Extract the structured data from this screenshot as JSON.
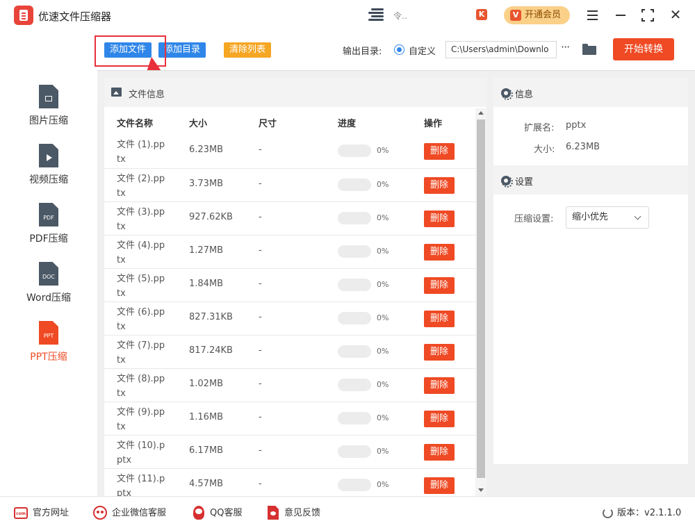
{
  "window": {
    "title": "优速文件压缩器",
    "user_name": "令‥",
    "vip_label": "开通会员",
    "vip_icon_text": "V",
    "k_badge": "K"
  },
  "toolbar": {
    "add_file_label": "添加文件",
    "add_dir_label": "添加目录",
    "clear_label": "清除列表",
    "output_dir_label": "输出目录:",
    "custom_label": "自定义",
    "path_value": "C:\\Users\\admin\\Downlo",
    "more_label": "···",
    "start_label": "开始转换"
  },
  "sidebar": {
    "items": [
      {
        "label": "图片压缩",
        "icon": "image-doc-icon",
        "active": false
      },
      {
        "label": "视频压缩",
        "icon": "video-doc-icon",
        "active": false
      },
      {
        "label": "PDF压缩",
        "icon": "pdf-doc-icon",
        "icon_text": "PDF",
        "active": false
      },
      {
        "label": "Word压缩",
        "icon": "word-doc-icon",
        "icon_text": "DOC",
        "active": false
      },
      {
        "label": "PPT压缩",
        "icon": "ppt-doc-icon",
        "icon_text": "PPT",
        "active": true
      }
    ]
  },
  "file_panel": {
    "title": "文件信息",
    "columns": [
      "文件名称",
      "大小",
      "尺寸",
      "进度",
      "操作"
    ],
    "rows": [
      {
        "name": "文件 (1).pptx",
        "size": "6.23MB",
        "dimension": "-",
        "progress": 0,
        "progress_text": "0%",
        "action": "删除"
      },
      {
        "name": "文件 (2).pptx",
        "size": "3.73MB",
        "dimension": "-",
        "progress": 0,
        "progress_text": "0%",
        "action": "删除"
      },
      {
        "name": "文件 (3).pptx",
        "size": "927.62KB",
        "dimension": "-",
        "progress": 0,
        "progress_text": "0%",
        "action": "删除"
      },
      {
        "name": "文件 (4).pptx",
        "size": "1.27MB",
        "dimension": "-",
        "progress": 0,
        "progress_text": "0%",
        "action": "删除"
      },
      {
        "name": "文件 (5).pptx",
        "size": "1.84MB",
        "dimension": "-",
        "progress": 0,
        "progress_text": "0%",
        "action": "删除"
      },
      {
        "name": "文件 (6).pptx",
        "size": "827.31KB",
        "dimension": "-",
        "progress": 0,
        "progress_text": "0%",
        "action": "删除"
      },
      {
        "name": "文件 (7).pptx",
        "size": "817.24KB",
        "dimension": "-",
        "progress": 0,
        "progress_text": "0%",
        "action": "删除"
      },
      {
        "name": "文件 (8).pptx",
        "size": "1.02MB",
        "dimension": "-",
        "progress": 0,
        "progress_text": "0%",
        "action": "删除"
      },
      {
        "name": "文件 (9).pptx",
        "size": "1.16MB",
        "dimension": "-",
        "progress": 0,
        "progress_text": "0%",
        "action": "删除"
      },
      {
        "name": "文件 (10).pptx",
        "size": "6.17MB",
        "dimension": "-",
        "progress": 0,
        "progress_text": "0%",
        "action": "删除"
      },
      {
        "name": "文件 (11).pptx",
        "size": "4.57MB",
        "dimension": "-",
        "progress": 0,
        "progress_text": "0%",
        "action": "删除"
      }
    ]
  },
  "info_panel": {
    "title": "信息",
    "ext_label": "扩展名:",
    "ext_value": "pptx",
    "size_label": "大小:",
    "size_value": "6.23MB"
  },
  "settings_panel": {
    "title": "设置",
    "compress_label": "压缩设置:",
    "compress_value": "缩小优先"
  },
  "footer": {
    "website": "官方网址",
    "wechat": "企业微信客服",
    "qq": "QQ客服",
    "feedback": "意见反馈",
    "version": "版本：v2.1.1.0"
  },
  "colors": {
    "accent_blue": "#2f86e8",
    "accent_red": "#ef4a24",
    "clear_orange": "#f5a623",
    "vip_gold": "#fbd089",
    "highlight": "#e8303a"
  }
}
